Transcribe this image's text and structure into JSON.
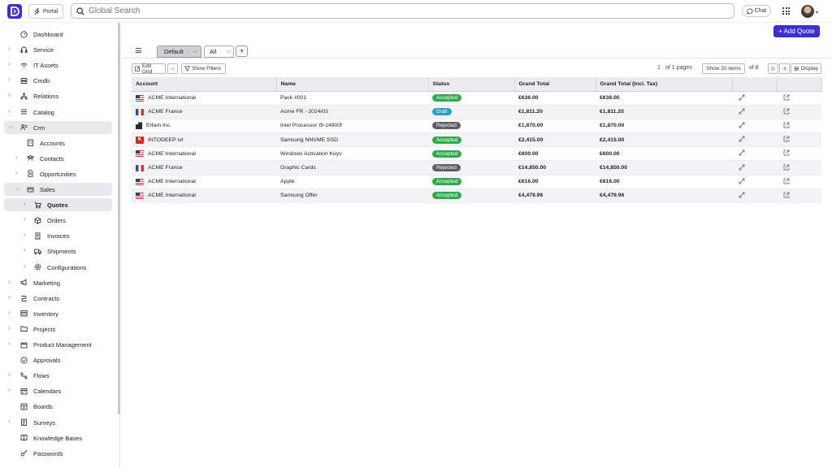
{
  "topbar": {
    "portal_label": "Portal",
    "search_placeholder": "Global Search",
    "chat_label": "Chat"
  },
  "sidebar": {
    "items": [
      {
        "label": "Dashboard",
        "icon": "dashboard-icon",
        "expandable": false
      },
      {
        "label": "Service",
        "icon": "service-icon",
        "expandable": true
      },
      {
        "label": "IT Assets",
        "icon": "wifi-icon",
        "expandable": true
      },
      {
        "label": "Cmdb",
        "icon": "database-icon",
        "expandable": true
      },
      {
        "label": "Relations",
        "icon": "relations-icon",
        "expandable": true
      },
      {
        "label": "Catalog",
        "icon": "catalog-icon",
        "expandable": true
      },
      {
        "label": "Crm",
        "icon": "crm-icon",
        "expandable": true,
        "expanded": true
      },
      {
        "label": "Accounts",
        "icon": "building-icon",
        "expandable": false,
        "level": 1
      },
      {
        "label": "Contacts",
        "icon": "contacts-icon",
        "expandable": true,
        "level": 1
      },
      {
        "label": "Opportunities",
        "icon": "document-icon",
        "expandable": true,
        "level": 1
      },
      {
        "label": "Sales",
        "icon": "sales-icon",
        "expandable": true,
        "expanded": true,
        "level": 1
      },
      {
        "label": "Quotes",
        "icon": "cart-icon",
        "expandable": true,
        "level": 2,
        "active": true
      },
      {
        "label": "Orders",
        "icon": "cube-icon",
        "expandable": true,
        "level": 2
      },
      {
        "label": "Invoices",
        "icon": "invoice-icon",
        "expandable": true,
        "level": 2
      },
      {
        "label": "Shipments",
        "icon": "truck-icon",
        "expandable": true,
        "level": 2
      },
      {
        "label": "Configurations",
        "icon": "gear-icon",
        "expandable": true,
        "level": 2
      },
      {
        "label": "Marketing",
        "icon": "megaphone-icon",
        "expandable": true
      },
      {
        "label": "Contracts",
        "icon": "contracts-icon",
        "expandable": true
      },
      {
        "label": "Inventory",
        "icon": "inventory-icon",
        "expandable": true
      },
      {
        "label": "Projects",
        "icon": "folder-icon",
        "expandable": true
      },
      {
        "label": "Product Management",
        "icon": "box-icon",
        "expandable": true
      },
      {
        "label": "Approvals",
        "icon": "check-circle-icon",
        "expandable": false
      },
      {
        "label": "Flows",
        "icon": "flows-icon",
        "expandable": true
      },
      {
        "label": "Calendars",
        "icon": "calendar-icon",
        "expandable": true
      },
      {
        "label": "Boards",
        "icon": "boards-icon",
        "expandable": false
      },
      {
        "label": "Surveys",
        "icon": "survey-icon",
        "expandable": true
      },
      {
        "label": "Knowledge Bases",
        "icon": "book-icon",
        "expandable": false
      },
      {
        "label": "Passwords",
        "icon": "key-icon",
        "expandable": false
      }
    ]
  },
  "main": {
    "add_button_label": "+ Add Quote",
    "views": {
      "selected": "Default",
      "filter": "All"
    },
    "toolbar": {
      "edit_grid_label": "Edit Grid",
      "show_filters_label": "Show Filters",
      "page_value": "1",
      "pages_text": "of 1 pages",
      "page_size_label": "Show 20 items",
      "total_text": "of 8",
      "display_label": "Display"
    },
    "table": {
      "columns": [
        "Account",
        "Name",
        "Status",
        "Grand Total",
        "Grand Total (Incl. Tax)"
      ],
      "rows": [
        {
          "account": "ACME International",
          "flag": "us",
          "name": "Pack #001",
          "status": "Accepted",
          "grand_total": "€636.00",
          "grand_total_tax": "€636.00"
        },
        {
          "account": "ACME France",
          "flag": "fr",
          "name": "Acme FR - 2024/03",
          "status": "Draft",
          "grand_total": "€1,811.20",
          "grand_total_tax": "€1,811.20"
        },
        {
          "account": "Erfam Inc.",
          "flag": "bld",
          "name": "Intel Processor I9-14900f",
          "status": "Rejected",
          "grand_total": "€1,870.00",
          "grand_total_tax": "€1,870.00"
        },
        {
          "account": "INTODEEP srl",
          "flag": "kp",
          "name": "Samsung NNVME SSD",
          "status": "Accepted",
          "grand_total": "€2,415.00",
          "grand_total_tax": "€2,415.00"
        },
        {
          "account": "ACME International",
          "flag": "us",
          "name": "Windows Activation Keys",
          "status": "Accepted",
          "grand_total": "€600.00",
          "grand_total_tax": "€600.00"
        },
        {
          "account": "ACME France",
          "flag": "fr",
          "name": "Graphic Cards",
          "status": "Rejected",
          "grand_total": "€14,850.00",
          "grand_total_tax": "€14,850.00"
        },
        {
          "account": "ACME International",
          "flag": "us",
          "name": "Apple",
          "status": "Accepted",
          "grand_total": "€616.00",
          "grand_total_tax": "€616.00"
        },
        {
          "account": "ACME International",
          "flag": "us",
          "name": "Samsung Offer",
          "status": "Accepted",
          "grand_total": "€4,479.96",
          "grand_total_tax": "€4,479.96"
        }
      ]
    }
  },
  "colors": {
    "accent": "#3b2fd0",
    "accepted": "#2eaa4a",
    "draft": "#2a9ec4",
    "rejected": "#5d5d63"
  }
}
